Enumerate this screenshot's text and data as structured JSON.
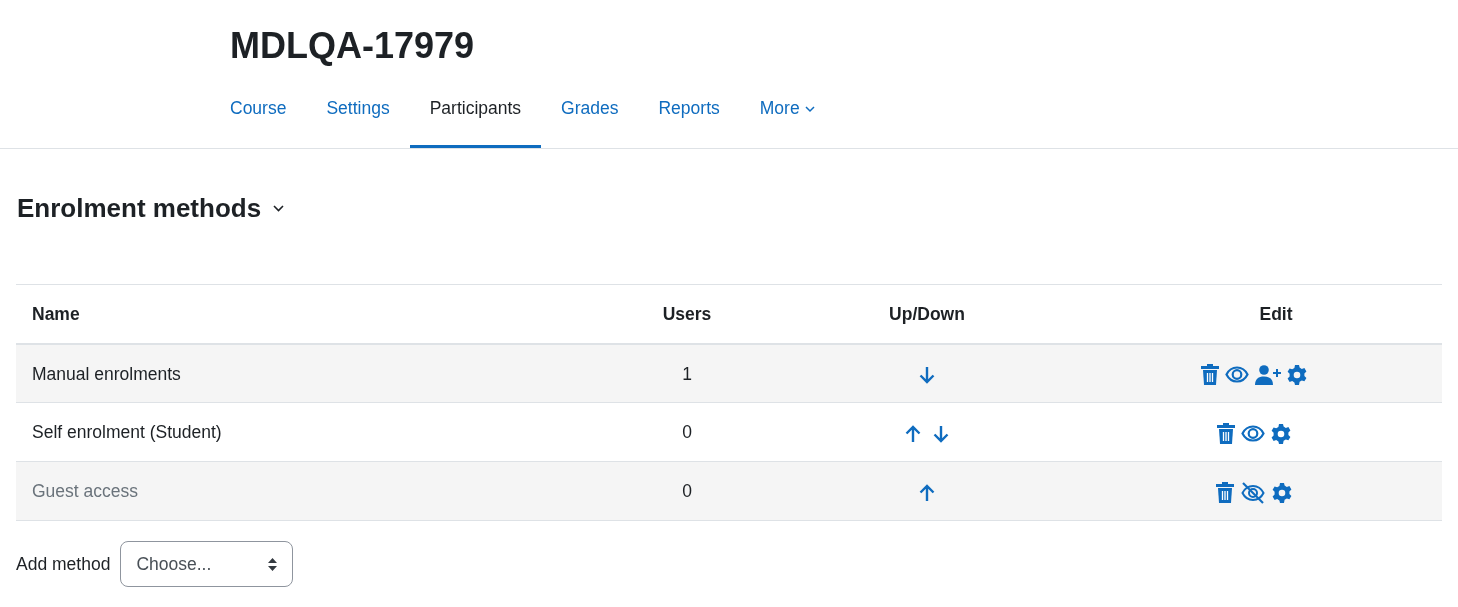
{
  "course_title": "MDLQA-17979",
  "tabs": [
    {
      "label": "Course",
      "selected": false
    },
    {
      "label": "Settings",
      "selected": false
    },
    {
      "label": "Participants",
      "selected": true
    },
    {
      "label": "Grades",
      "selected": false
    },
    {
      "label": "Reports",
      "selected": false
    },
    {
      "label": "More",
      "selected": false,
      "kind": "dropdown"
    }
  ],
  "heading": "Enrolment methods",
  "table": {
    "columns": [
      "Name",
      "Users",
      "Up/Down",
      "Edit"
    ],
    "rows": [
      {
        "name": "Manual enrolments",
        "users": "1",
        "visible": true,
        "can_move_up": false,
        "can_move_down": true,
        "can_enrol_users": true
      },
      {
        "name": "Self enrolment (Student)",
        "users": "0",
        "visible": true,
        "can_move_up": true,
        "can_move_down": true,
        "can_enrol_users": false
      },
      {
        "name": "Guest access",
        "users": "0",
        "visible": false,
        "can_move_up": true,
        "can_move_down": false,
        "can_enrol_users": false
      }
    ]
  },
  "add_method": {
    "label": "Add method",
    "value": "Choose..."
  }
}
